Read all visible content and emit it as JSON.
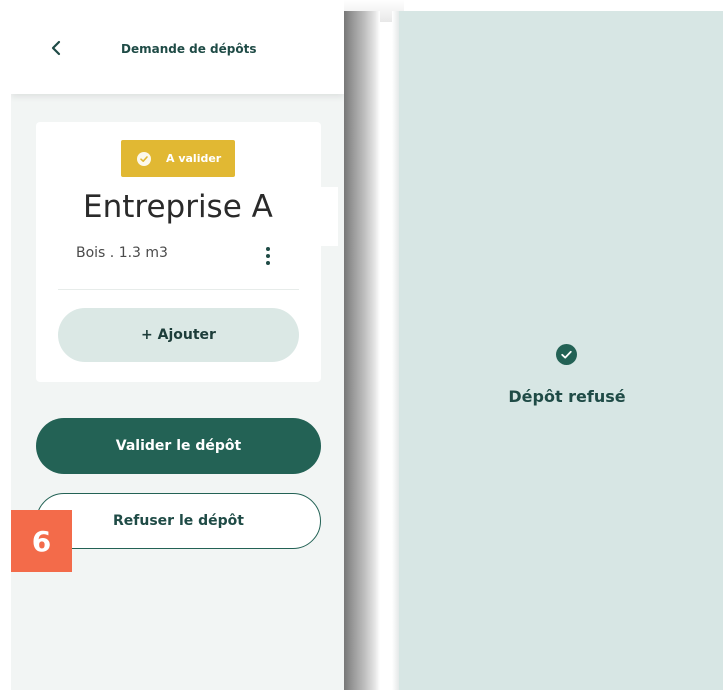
{
  "left_screen": {
    "header": {
      "title": "Demande de dépôts",
      "back_icon": "chevron-left-icon"
    },
    "card": {
      "status_badge": {
        "label": "A valider",
        "icon": "check-circle-icon",
        "color": "#e1b833"
      },
      "company_name": "Entreprise A",
      "material": "Bois . 1.3 m3",
      "menu_icon": "more-vertical-icon",
      "add_button_label": "+ Ajouter"
    },
    "validate_button_label": "Valider le dépôt",
    "refuse_button_label": "Refuser le dépôt",
    "step_marker": "6"
  },
  "right_screen": {
    "status_icon": "check-circle-icon",
    "status_text": "Dépôt refusé"
  },
  "colors": {
    "primary": "#236255",
    "badge": "#e1b833",
    "marker": "#f36b4a",
    "right_background": "#d7e6e4",
    "left_background": "#f2f5f4"
  }
}
